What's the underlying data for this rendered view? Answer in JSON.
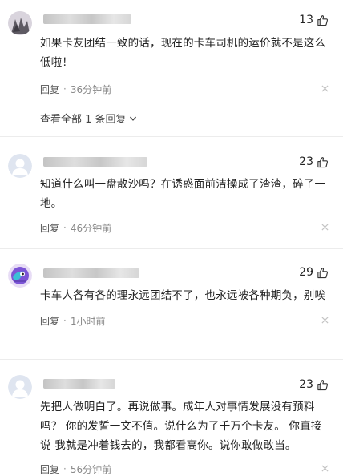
{
  "comments": [
    {
      "likes": "13",
      "text": "如果卡友团结一致的话，现在的卡车司机的运价就不是这么低啦！",
      "reply_label": "回复",
      "separator": "·",
      "time": "36分钟前",
      "view_all": "查看全部 1 条回复"
    },
    {
      "likes": "23",
      "text": "知道什么叫一盘散沙吗？在诱惑面前洁操成了渣渣，碎了一地。",
      "reply_label": "回复",
      "separator": "·",
      "time": "46分钟前"
    },
    {
      "likes": "29",
      "text": "卡车人各有各的理永远团结不了，也永远被各种期负，别唉",
      "reply_label": "回复",
      "separator": "·",
      "time": "1小时前"
    },
    {
      "likes": "23",
      "text": "先把人做明白了。再说做事。成年人对事情发展没有预料吗？ 你的发誓一文不值。说什么为了千万个卡友。 你直接说 我就是冲着钱去的，我都看高你。说你敢做敢当。",
      "reply_label": "回复",
      "separator": "·",
      "time": "56分钟前"
    }
  ],
  "colors": {
    "text": "#222222",
    "meta": "#888888",
    "divider": "#ececec"
  }
}
